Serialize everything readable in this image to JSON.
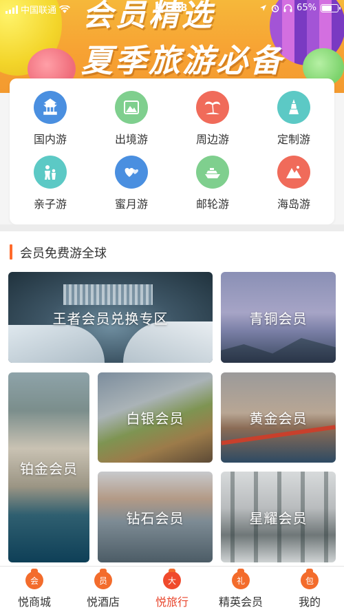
{
  "status_bar": {
    "carrier": "中国联通",
    "time": "11:08",
    "battery": "65%",
    "battery_level": 0.65
  },
  "banner": {
    "title_top": "会员精选",
    "title": "夏季旅游必备"
  },
  "categories": [
    {
      "label": "国内游",
      "icon": "temple-icon",
      "color": "#4a8fe0"
    },
    {
      "label": "出境游",
      "icon": "mountain-icon",
      "color": "#7fcf8e"
    },
    {
      "label": "周边游",
      "icon": "palm-tree-icon",
      "color": "#f06b5a"
    },
    {
      "label": "定制游",
      "icon": "tower-icon",
      "color": "#5cc9c5"
    },
    {
      "label": "亲子游",
      "icon": "family-icon",
      "color": "#5cc9c5"
    },
    {
      "label": "蜜月游",
      "icon": "hearts-icon",
      "color": "#4a8fe0"
    },
    {
      "label": "邮轮游",
      "icon": "cruise-ship-icon",
      "color": "#7fcf8e"
    },
    {
      "label": "海岛游",
      "icon": "island-icon",
      "color": "#f06b5a"
    }
  ],
  "section": {
    "title": "会员免费游全球"
  },
  "tiles": {
    "wangzhe": "王者会员兑换专区",
    "qingtong": "青铜会员",
    "bojin": "铂金会员",
    "baiyin": "白银会员",
    "huangjin": "黄金会员",
    "zuanshi": "钻石会员",
    "xingyao": "星耀会员"
  },
  "bottom_nav": [
    {
      "label": "悦商城",
      "icon_char": "会",
      "icon": "bag-icon"
    },
    {
      "label": "悦酒店",
      "icon_char": "员",
      "icon": "bag-icon"
    },
    {
      "label": "悦旅行",
      "icon_char": "大",
      "icon": "bag-icon",
      "active": true
    },
    {
      "label": "精英会员",
      "icon_char": "礼",
      "icon": "bag-icon"
    },
    {
      "label": "我的",
      "icon_char": "包",
      "icon": "bag-icon"
    }
  ]
}
